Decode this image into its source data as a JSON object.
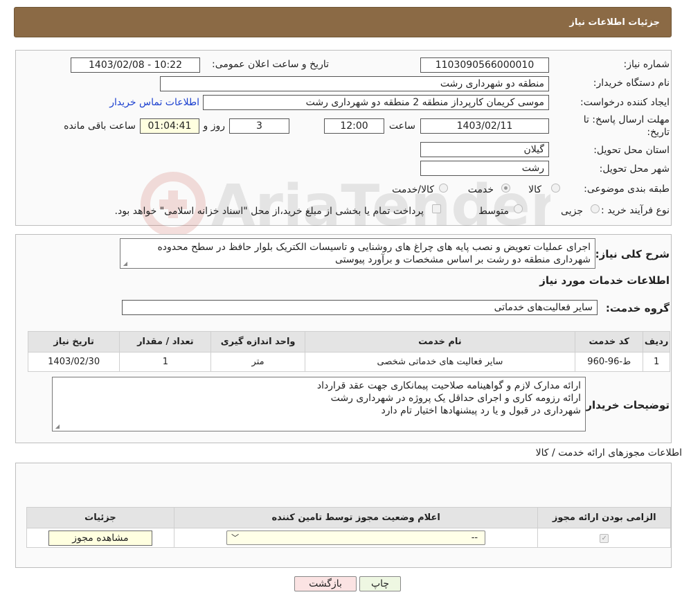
{
  "header": {
    "title": "جزئیات اطلاعات نیاز"
  },
  "watermark": {
    "text": "AriaTender.neT"
  },
  "details": {
    "need_number_label": "شماره نیاز:",
    "need_number": "1103090566000010",
    "announce_label": "تاریخ و ساعت اعلان عمومی:",
    "announce_value": "1403/02/08 - 10:22",
    "buyer_org_label": "نام دستگاه خریدار:",
    "buyer_org": "منطقه دو شهرداری رشت",
    "creator_label": "ایجاد کننده درخواست:",
    "creator": "موسی کریمان کارپرداز منطقه 2 منطقه دو شهرداری رشت",
    "contact_link": "اطلاعات تماس خریدار",
    "deadline_label": "مهلت ارسال پاسخ: تا تاریخ:",
    "deadline_date": "1403/02/11",
    "time_label": "ساعت",
    "deadline_time": "12:00",
    "days_value": "3",
    "days_label": "روز و",
    "remaining_time": "01:04:41",
    "remaining_label": "ساعت باقی مانده",
    "province_label": "استان محل تحویل:",
    "province": "گیلان",
    "city_label": "شهر محل تحویل:",
    "city": "رشت",
    "category_label": "طبقه بندی موضوعی:",
    "category_options": [
      {
        "label": "کالا",
        "selected": false
      },
      {
        "label": "خدمت",
        "selected": true
      },
      {
        "label": "کالا/خدمت",
        "selected": false
      }
    ],
    "purchase_type_label": "نوع فرآیند خرید :",
    "purchase_options": [
      {
        "label": "جزیی",
        "selected": false
      },
      {
        "label": "متوسط",
        "selected": false
      }
    ],
    "payment_note": "پرداخت تمام یا بخشی از مبلغ خرید،از محل \"اسناد خزانه اسلامی\" خواهد بود."
  },
  "description": {
    "label": "شرح کلی نیاز:",
    "text": "اجرای عملیات تعویض و نصب پایه های چراغ های روشنایی و تاسیسات الکتریک بلوار حافظ در سطح محدوده شهرداری منطقه دو رشت بر اساس مشخصات و برآورد پیوستی"
  },
  "services": {
    "section_title": "اطلاعات خدمات مورد نیاز",
    "group_label": "گروه خدمت:",
    "group_value": "سایر فعالیت‌های خدماتی",
    "columns": [
      "ردیف",
      "کد خدمت",
      "نام خدمت",
      "واحد اندازه گیری",
      "تعداد / مقدار",
      "تاریخ نیاز"
    ],
    "rows": [
      [
        "1",
        "ط-96-960",
        "سایر فعالیت های خدماتی شخصی",
        "متر",
        "1",
        "1403/02/30"
      ]
    ]
  },
  "buyer_notes": {
    "label": "توضیحات خریدار:",
    "lines": [
      "ارائه مدارک لازم و گواهینامه صلاحیت پیمانکاری جهت عقد قرارداد",
      "ارائه رزومه کاری و اجرای حداقل یک پروژه در شهرداری رشت",
      "شهرداری در قبول و یا رد پیشنهادها اختیار تام دارد"
    ]
  },
  "permits": {
    "section_title": "اطلاعات مجوزهای ارائه خدمت / کالا",
    "columns": [
      "الزامی بودن ارائه مجوز",
      "اعلام وضعیت مجوز توسط تامین کننده",
      "جزئیات"
    ],
    "row": {
      "required_checked": true,
      "status_value": "--",
      "details_button": "مشاهده مجوز"
    }
  },
  "footer": {
    "print_button": "چاپ",
    "back_button": "بازگشت"
  }
}
